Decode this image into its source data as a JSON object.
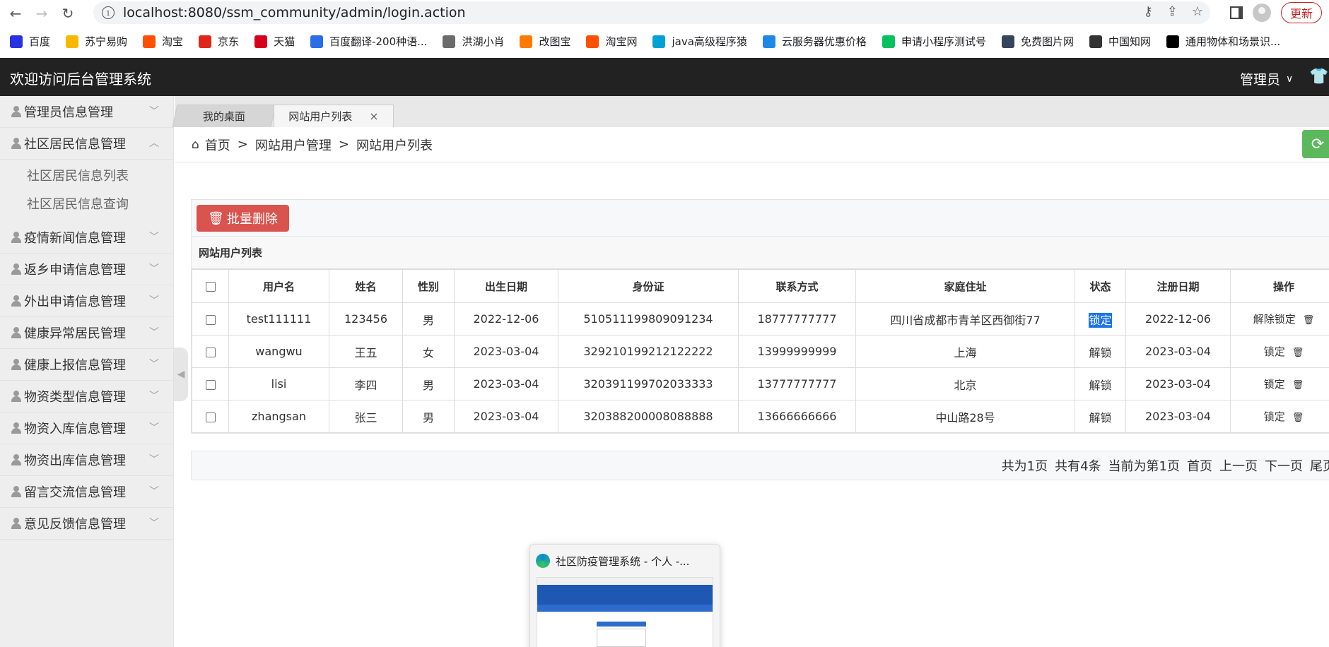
{
  "browser": {
    "url": "localhost:8080/ssm_community/admin/login.action",
    "update_label": "更新",
    "bookmarks": [
      {
        "label": "百度",
        "icon": "baidu-icon",
        "color": "#2932e1"
      },
      {
        "label": "苏宁易购",
        "icon": "suning-icon",
        "color": "#f7b900"
      },
      {
        "label": "淘宝",
        "icon": "taobao-icon",
        "color": "#ff5000"
      },
      {
        "label": "京东",
        "icon": "jd-icon",
        "color": "#e1251b"
      },
      {
        "label": "天猫",
        "icon": "tmall-icon",
        "color": "#d6001c"
      },
      {
        "label": "百度翻译-200种语...",
        "icon": "fanyi-icon",
        "color": "#2b6de5"
      },
      {
        "label": "洪湖小肖",
        "icon": "hunter-icon",
        "color": "#6b6b6b"
      },
      {
        "label": "改图宝",
        "icon": "gaitubao-icon",
        "color": "#ff7a00"
      },
      {
        "label": "淘宝网",
        "icon": "taobao2-icon",
        "color": "#ff5000"
      },
      {
        "label": "java高级程序猿",
        "icon": "bilibili-icon",
        "color": "#00a1d6"
      },
      {
        "label": "云服务器优惠价格",
        "icon": "cloud-icon",
        "color": "#1e88e5"
      },
      {
        "label": "申请小程序测试号",
        "icon": "wechat-icon",
        "color": "#07c160"
      },
      {
        "label": "免费图片网",
        "icon": "tumblr-icon",
        "color": "#35465c"
      },
      {
        "label": "中国知网",
        "icon": "cnki-icon",
        "color": "#333333"
      },
      {
        "label": "通用物体和场景识...",
        "icon": "ai-icon",
        "color": "#000000"
      }
    ]
  },
  "header": {
    "title": "欢迎访问后台管理系统",
    "admin_label": "管理员"
  },
  "sidebar": {
    "items": [
      {
        "label": "管理员信息管理",
        "expanded": false
      },
      {
        "label": "社区居民信息管理",
        "expanded": true,
        "children": [
          "社区居民信息列表",
          "社区居民信息查询"
        ]
      },
      {
        "label": "疫情新闻信息管理",
        "expanded": false
      },
      {
        "label": "返乡申请信息管理",
        "expanded": false
      },
      {
        "label": "外出申请信息管理",
        "expanded": false
      },
      {
        "label": "健康异常居民管理",
        "expanded": false
      },
      {
        "label": "健康上报信息管理",
        "expanded": false
      },
      {
        "label": "物资类型信息管理",
        "expanded": false
      },
      {
        "label": "物资入库信息管理",
        "expanded": false
      },
      {
        "label": "物资出库信息管理",
        "expanded": false
      },
      {
        "label": "留言交流信息管理",
        "expanded": false
      },
      {
        "label": "意见反馈信息管理",
        "expanded": false
      }
    ]
  },
  "tabs": [
    {
      "label": "我的桌面"
    },
    {
      "label": "网站用户列表",
      "close": "×"
    }
  ],
  "breadcrumb": [
    "首页",
    "网站用户管理",
    "网站用户列表"
  ],
  "breadcrumb_sep": ">",
  "toolbar": {
    "batch_delete_label": "批量删除"
  },
  "table": {
    "title": "网站用户列表",
    "columns": [
      "用户名",
      "姓名",
      "性别",
      "出生日期",
      "身份证",
      "联系方式",
      "家庭住址",
      "状态",
      "注册日期",
      "操作"
    ],
    "rows": [
      {
        "username": "test111111",
        "name": "123456",
        "gender": "男",
        "birth": "2022-12-06",
        "id_card": "510511199809091234",
        "phone": "18777777777",
        "address": "四川省成都市青羊区西御街77",
        "status": "锁定",
        "reg_date": "2022-12-06",
        "action": "解除锁定"
      },
      {
        "username": "wangwu",
        "name": "王五",
        "gender": "女",
        "birth": "2023-03-04",
        "id_card": "329210199212122222",
        "phone": "13999999999",
        "address": "上海",
        "status": "解锁",
        "reg_date": "2023-03-04",
        "action": "锁定"
      },
      {
        "username": "lisi",
        "name": "李四",
        "gender": "男",
        "birth": "2023-03-04",
        "id_card": "320391199702033333",
        "phone": "13777777777",
        "address": "北京",
        "status": "解锁",
        "reg_date": "2023-03-04",
        "action": "锁定"
      },
      {
        "username": "zhangsan",
        "name": "张三",
        "gender": "男",
        "birth": "2023-03-04",
        "id_card": "320388200008088888",
        "phone": "13666666666",
        "address": "中山路28号",
        "status": "解锁",
        "reg_date": "2023-03-04",
        "action": "锁定"
      }
    ]
  },
  "pager": {
    "total_pages": "共为1页",
    "total_items": "共有4条",
    "current": "当前为第1页",
    "first": "首页",
    "prev": "上一页",
    "next": "下一页",
    "last": "尾页"
  },
  "preview": {
    "title": "社区防疫管理系统 - 个人 -..."
  },
  "colors": {
    "header_bg": "#222222",
    "danger": "#d9534f",
    "success": "#5cb85c",
    "selection": "#1a73e8"
  }
}
